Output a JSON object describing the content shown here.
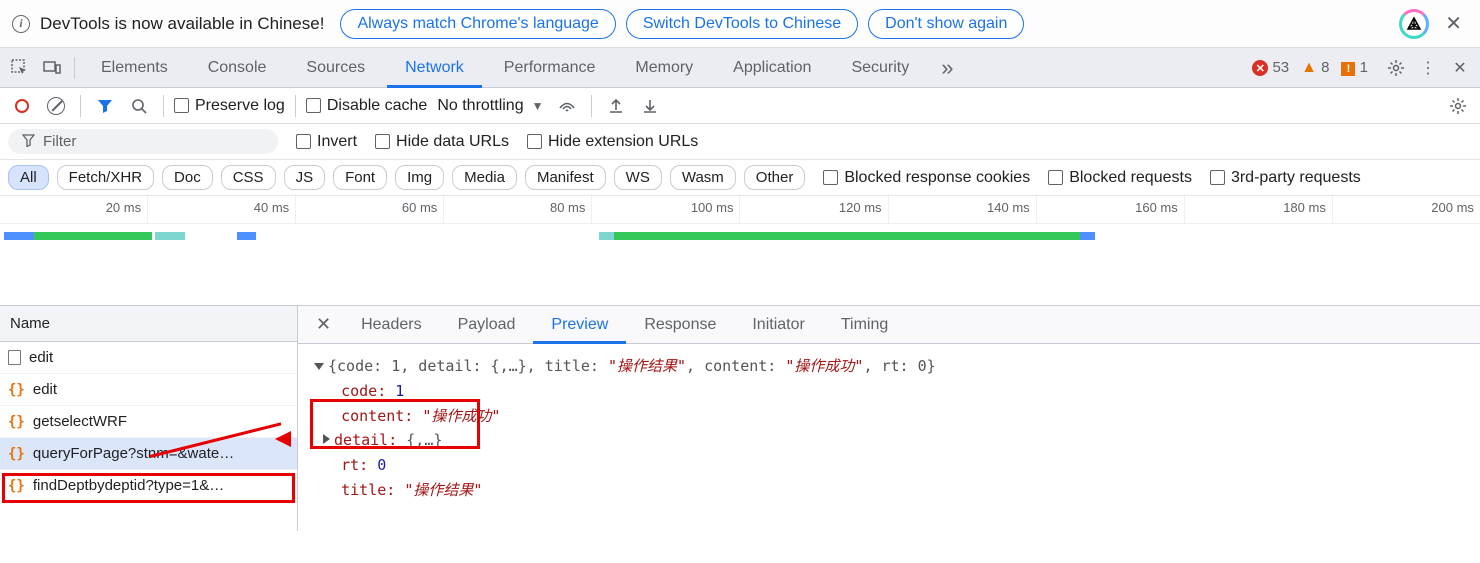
{
  "infobar": {
    "message": "DevTools is now available in Chinese!",
    "buttons": {
      "match": "Always match Chrome's language",
      "switch": "Switch DevTools to Chinese",
      "dismiss": "Don't show again"
    }
  },
  "tabs": {
    "items": [
      "Elements",
      "Console",
      "Sources",
      "Network",
      "Performance",
      "Memory",
      "Application",
      "Security"
    ],
    "active": "Network",
    "counts": {
      "errors": "53",
      "warnings": "8",
      "issues": "1"
    }
  },
  "toolbar": {
    "preserve": "Preserve log",
    "disable_cache": "Disable cache",
    "throttling": "No throttling"
  },
  "filter": {
    "placeholder": "Filter",
    "invert": "Invert",
    "hide_data": "Hide data URLs",
    "hide_ext": "Hide extension URLs"
  },
  "chips": {
    "items": [
      "All",
      "Fetch/XHR",
      "Doc",
      "CSS",
      "JS",
      "Font",
      "Img",
      "Media",
      "Manifest",
      "WS",
      "Wasm",
      "Other"
    ],
    "active": "All",
    "blocked_cookies": "Blocked response cookies",
    "blocked_req": "Blocked requests",
    "third_party": "3rd-party requests"
  },
  "timeline": {
    "ticks": [
      "20 ms",
      "40 ms",
      "60 ms",
      "80 ms",
      "100 ms",
      "120 ms",
      "140 ms",
      "160 ms",
      "180 ms",
      "200 ms"
    ]
  },
  "reqlist": {
    "header": "Name",
    "items": [
      {
        "icon": "doc",
        "name": "edit"
      },
      {
        "icon": "json",
        "name": "edit"
      },
      {
        "icon": "json",
        "name": "getselectWRF"
      },
      {
        "icon": "json",
        "name": "queryForPage?stnm=&wate…",
        "selected": true
      },
      {
        "icon": "json",
        "name": "findDeptbydeptid?type=1&…"
      }
    ]
  },
  "subtabs": {
    "items": [
      "Headers",
      "Payload",
      "Preview",
      "Response",
      "Initiator",
      "Timing"
    ],
    "active": "Preview"
  },
  "preview": {
    "summary_prefix": "{code: 1, detail: {,…},",
    "summary_mid": " title: ",
    "summary_title_val": "\"操作结果\"",
    "summary_c": ", content: ",
    "summary_content_val": "\"操作成功\"",
    "summary_suffix": ", rt: 0}",
    "code_key": "code:",
    "code_val": "1",
    "content_key": "content:",
    "content_val": "\"操作成功\"",
    "detail_key": "detail:",
    "detail_val": "{,…}",
    "rt_key": "rt:",
    "rt_val": "0",
    "title_key": "title:",
    "title_val": "\"操作结果\""
  }
}
